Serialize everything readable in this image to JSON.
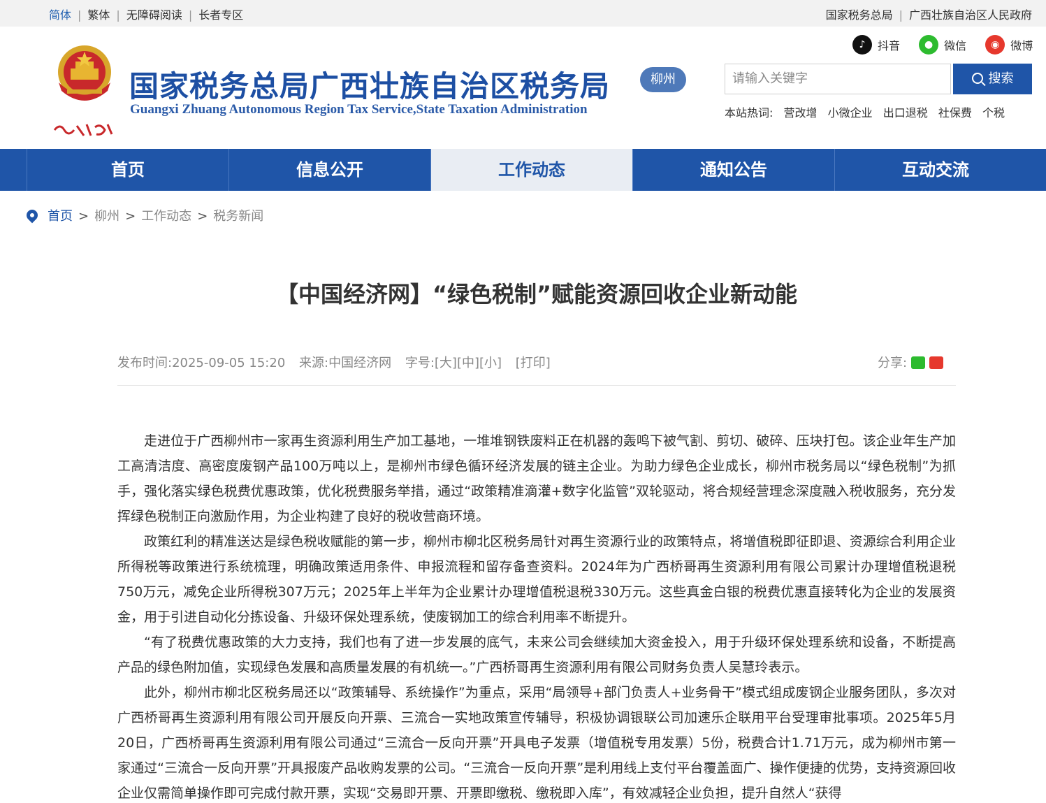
{
  "topbar": {
    "lang_simplified": "简体",
    "lang_traditional": "繁体",
    "accessible": "无障碍阅读",
    "elderly": "长者专区",
    "link_sat": "国家税务总局",
    "link_gov": "广西壮族自治区人民政府"
  },
  "header": {
    "title": "国家税务总局广西壮族自治区税务局",
    "subtitle": "Guangxi Zhuang Autonomous Region Tax Service,State Taxation Administration",
    "city": "柳州",
    "logo_text": "中国税务"
  },
  "social": {
    "douyin": "抖音",
    "wechat": "微信",
    "weibo": "微博"
  },
  "search": {
    "placeholder": "请输入关键字",
    "button": "搜索",
    "hot_label": "本站热词:",
    "hot_words": [
      "营改增",
      "小微企业",
      "出口退税",
      "社保费",
      "个税"
    ]
  },
  "nav": {
    "items": [
      "首页",
      "信息公开",
      "工作动态",
      "通知公告",
      "互动交流"
    ],
    "active": "工作动态"
  },
  "breadcrumb": [
    "首页",
    "柳州",
    "工作动态",
    "税务新闻"
  ],
  "article": {
    "title": "【中国经济网】“绿色税制”赋能资源回收企业新动能",
    "publish_label": "发布时间:",
    "publish_time": "2025-09-05 15:20",
    "source_label": "来源:",
    "source": "中国经济网",
    "font_label": "字号:",
    "font_options": "[大][中][小]",
    "print": "[打印]",
    "share_label": "分享:",
    "paragraphs": [
      "走进位于广西柳州市一家再生资源利用生产加工基地，一堆堆钢铁废料正在机器的轰鸣下被气割、剪切、破碎、压块打包。该企业年生产加工高清洁度、高密度废钢产品100万吨以上，是柳州市绿色循环经济发展的链主企业。为助力绿色企业成长，柳州市税务局以“绿色税制”为抓手，强化落实绿色税费优惠政策，优化税费服务举措，通过“政策精准滴灌+数字化监管”双轮驱动，将合规经营理念深度融入税收服务，充分发挥绿色税制正向激励作用，为企业构建了良好的税收营商环境。",
      "政策红利的精准送达是绿色税收赋能的第一步，柳州市柳北区税务局针对再生资源行业的政策特点，将增值税即征即退、资源综合利用企业所得税等政策进行系统梳理，明确政策适用条件、申报流程和留存备查资料。2024年为广西桥哥再生资源利用有限公司累计办理增值税退税750万元，减免企业所得税307万元；2025年上半年为企业累计办理增值税退税330万元。这些真金白银的税费优惠直接转化为企业的发展资金，用于引进自动化分拣设备、升级环保处理系统，使废钢加工的综合利用率不断提升。",
      "“有了税费优惠政策的大力支持，我们也有了进一步发展的底气，未来公司会继续加大资金投入，用于升级环保处理系统和设备，不断提高产品的绿色附加值，实现绿色发展和高质量发展的有机统一。”广西桥哥再生资源利用有限公司财务负责人吴慧玲表示。",
      "此外，柳州市柳北区税务局还以“政策辅导、系统操作”为重点，采用“局领导+部门负责人+业务骨干”模式组成废钢企业服务团队，多次对广西桥哥再生资源利用有限公司开展反向开票、三流合一实地政策宣传辅导，积极协调银联公司加速乐企联用平台受理审批事项。2025年5月20日，广西桥哥再生资源利用有限公司通过“三流合一反向开票”开具电子发票（增值税专用发票）5份，税费合计1.71万元，成为柳州市第一家通过“三流合一反向开票”开具报废产品收购发票的公司。“三流合一反向开票”是利用线上支付平台覆盖面广、操作便捷的优势，支持资源回收企业仅需简单操作即可完成付款开票，实现“交易即开票、开票即缴税、缴税即入库”，有效减轻企业负担，提升自然人“获得"
    ]
  }
}
